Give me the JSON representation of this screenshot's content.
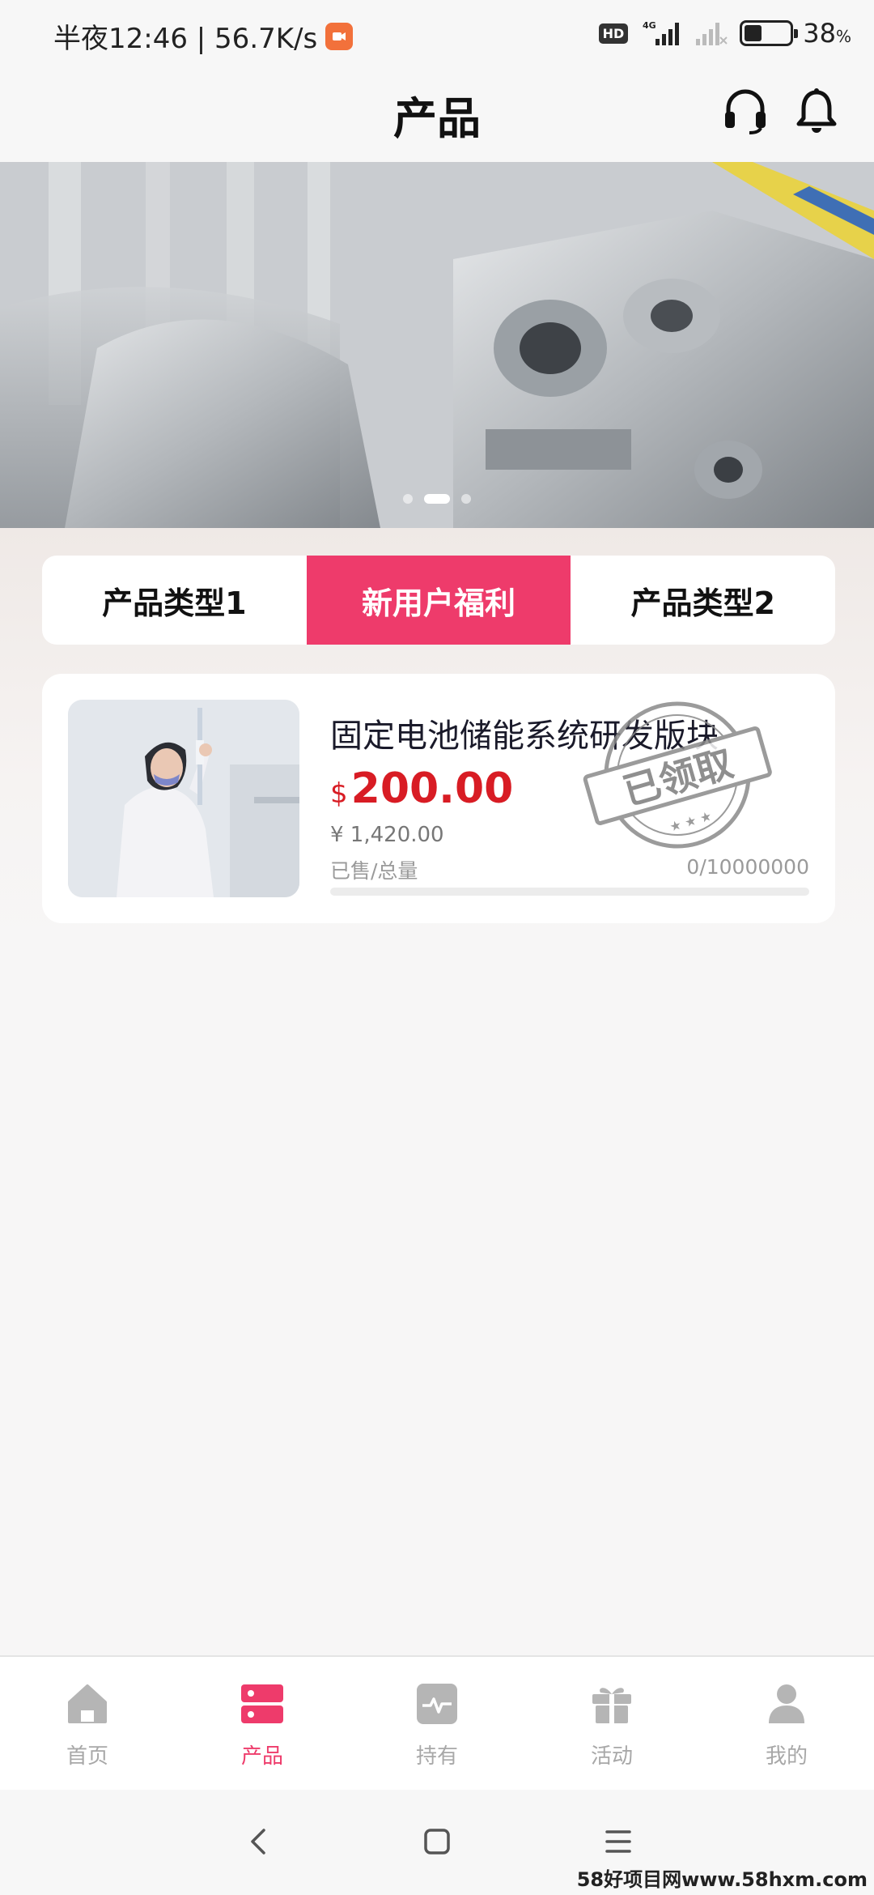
{
  "status_bar": {
    "time": "半夜12:46 | 56.7K/s",
    "network_badge": "HD",
    "network_type": "4G",
    "battery_level": 0.38,
    "battery_text": "38",
    "battery_unit": "%"
  },
  "header": {
    "title": "产品",
    "icons": [
      "headset-icon",
      "bell-icon"
    ]
  },
  "banner": {
    "slide_count": 3,
    "active_slide": 1
  },
  "tabs": [
    {
      "label": "产品类型1",
      "active": false
    },
    {
      "label": "新用户福利",
      "active": true
    },
    {
      "label": "产品类型2",
      "active": false
    }
  ],
  "product": {
    "name": "固定电池储能系统研发版块",
    "price_currency": "$",
    "price": "200.00",
    "original_price": "¥ 1,420.00",
    "sold_label": "已售/总量",
    "sold_count": "0/10000000",
    "progress": 0,
    "stamp_text": "已领取"
  },
  "bottom_nav": [
    {
      "label": "首页",
      "icon": "home-icon",
      "active": false
    },
    {
      "label": "产品",
      "icon": "product-icon",
      "active": true
    },
    {
      "label": "持有",
      "icon": "holdings-icon",
      "active": false
    },
    {
      "label": "活动",
      "icon": "gift-icon",
      "active": false
    },
    {
      "label": "我的",
      "icon": "profile-icon",
      "active": false
    }
  ],
  "watermark": "58好项目网www.58hxm.com",
  "colors": {
    "accent": "#ee3b6b",
    "price": "#d81c24",
    "inactive": "#a8a8a8"
  }
}
